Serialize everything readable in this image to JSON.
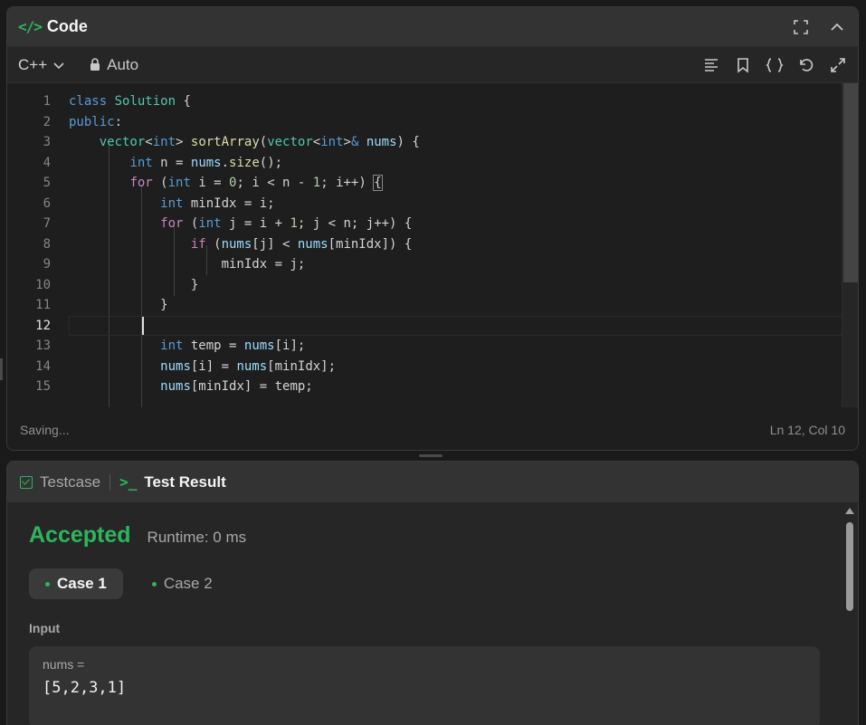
{
  "code_panel": {
    "title": "Code",
    "language": "C++",
    "auto_label": "Auto",
    "status": "Saving...",
    "cursor_position": "Ln 12, Col 10"
  },
  "editor": {
    "line_numbers": [
      "1",
      "2",
      "3",
      "4",
      "5",
      "6",
      "7",
      "8",
      "9",
      "10",
      "11",
      "12",
      "13",
      "14",
      "15"
    ],
    "active_line": "12"
  },
  "result_panel": {
    "tabs": {
      "testcase": "Testcase",
      "test_result": "Test Result"
    },
    "verdict": "Accepted",
    "runtime": "Runtime: 0 ms",
    "cases": [
      "Case 1",
      "Case 2"
    ],
    "input_label": "Input",
    "input_var": "nums =",
    "input_value": "[5,2,3,1]"
  },
  "icons": {
    "header": [
      "fullscreen-icon",
      "chevron-up-icon"
    ],
    "toolbar": [
      "format-icon",
      "bookmark-icon",
      "braces-icon",
      "undo-icon",
      "expand-icon"
    ]
  },
  "colors": {
    "accent": "#2db55d"
  }
}
